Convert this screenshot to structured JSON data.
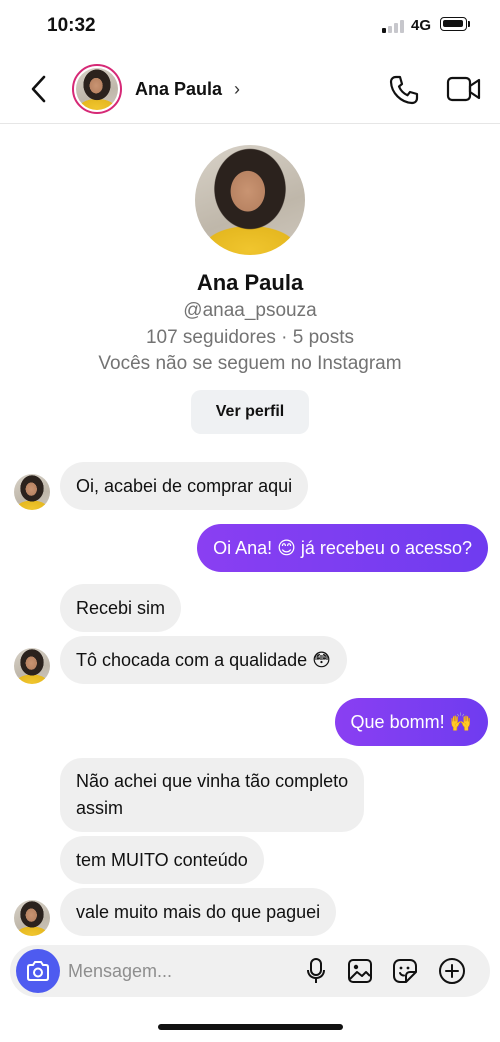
{
  "status_bar": {
    "time": "10:32",
    "network": "4G"
  },
  "header": {
    "name": "Ana Paula",
    "chevron": "›"
  },
  "profile": {
    "name": "Ana Paula",
    "handle": "@anaa_psouza",
    "stats": "107 seguidores · 5 posts",
    "note": "Vocês não se seguem no Instagram",
    "view_profile_label": "Ver perfil"
  },
  "messages": [
    {
      "side": "in",
      "text": "Oi, acabei de comprar aqui"
    },
    {
      "side": "out",
      "text": "Oi Ana! 😊 já recebeu o acesso?"
    },
    {
      "side": "in",
      "text": "Recebi sim"
    },
    {
      "side": "in",
      "text": "Tô chocada com a qualidade 😳"
    },
    {
      "side": "out",
      "text": "Que bomm! 🙌"
    },
    {
      "side": "in",
      "lines": [
        "Não achei que vinha tão completo",
        "assim"
      ]
    },
    {
      "side": "in",
      "text": "tem MUITO conteúdo"
    },
    {
      "side": "in",
      "text": "vale muito mais do que paguei"
    }
  ],
  "composer": {
    "placeholder": "Mensagem..."
  },
  "colors": {
    "outgoing_bubble": "#7a3df0",
    "incoming_bubble": "#efefef",
    "camera_button": "#4e5bf0",
    "story_ring": "#d62976"
  },
  "icons": [
    "back-icon",
    "phone-icon",
    "video-camera-icon",
    "camera-icon",
    "microphone-icon",
    "image-icon",
    "sticker-icon",
    "plus-circle-icon"
  ]
}
